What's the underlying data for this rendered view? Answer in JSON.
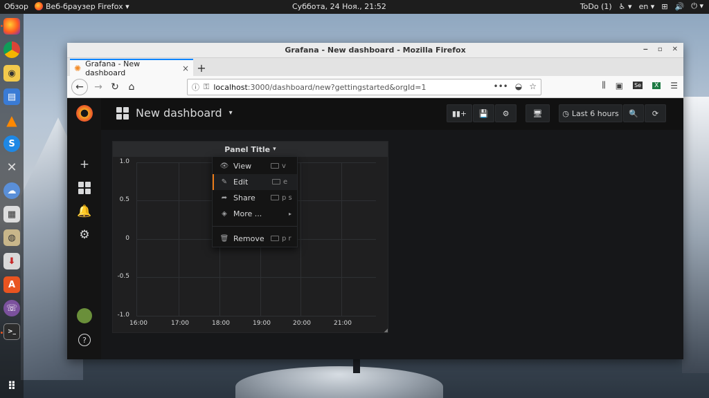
{
  "topbar": {
    "overview": "Обзор",
    "app_name": "Веб-браузер Firefox",
    "datetime": "Суббота, 24 Ноя., 21:52",
    "todo": "ToDo (1)",
    "lang": "en"
  },
  "window": {
    "title": "Grafana - New dashboard - Mozilla Firefox"
  },
  "tab": {
    "label": "Grafana - New dashboard",
    "close": "×"
  },
  "newtab": "+",
  "url": {
    "host": "localhost",
    "path": ":3000/dashboard/new?gettingstarted&orgId=1",
    "dots": "•••"
  },
  "grafana": {
    "dashboard_title": "New dashboard",
    "time_range": "Last 6 hours",
    "panel_title": "Panel Title",
    "y_ticks": [
      "1.0",
      "0.5",
      "0",
      "-0.5",
      "-1.0"
    ],
    "x_ticks": [
      "16:00",
      "17:00",
      "18:00",
      "19:00",
      "20:00",
      "21:00"
    ],
    "menu": [
      {
        "label": "View",
        "shortcut": "v",
        "icon": "eye-icon"
      },
      {
        "label": "Edit",
        "shortcut": "e",
        "icon": "edit-icon",
        "active": true
      },
      {
        "label": "Share",
        "shortcut": "p s",
        "icon": "share-icon"
      },
      {
        "label": "More ...",
        "shortcut": "",
        "icon": "cube-icon",
        "submenu": true
      },
      {
        "label": "Remove",
        "shortcut": "p r",
        "icon": "trash-icon"
      }
    ]
  },
  "colors": {
    "accent": "#eb7b18",
    "grafana_bg": "#161719",
    "sidebar_bg": "#141414",
    "tab_highlight": "#0a84ff"
  }
}
